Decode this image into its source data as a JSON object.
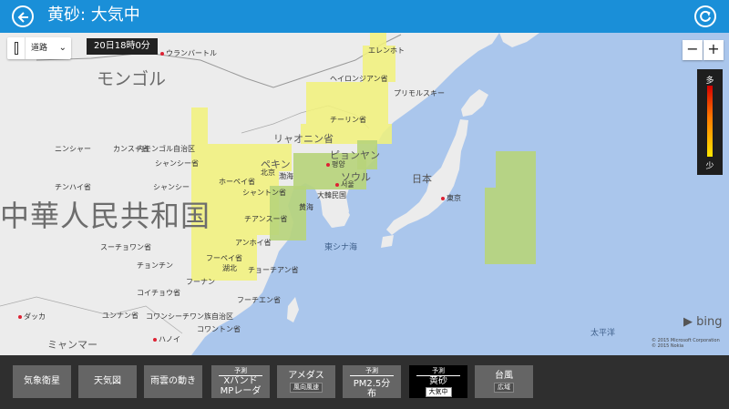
{
  "header": {
    "title": "黄砂: 大気中"
  },
  "map_controls": {
    "layer_select": "道路",
    "time": "20日18時0分",
    "zoom_out": "−",
    "zoom_in": "+",
    "legend": {
      "high": "多",
      "low": "少"
    }
  },
  "map_labels": {
    "mongolia": "モンゴル",
    "china": "中華人民共和国",
    "ulaanbaatar": "ウランバートル",
    "erenhot": "エレンホト",
    "heilongjiang": "ヘイロンジアン省",
    "primorsky": "プリモルスキー",
    "jilin": "チーリン省",
    "liaoning": "リャオニン省",
    "pyongyang": "ピョンヤン",
    "pyongyang_han": "평양",
    "seoul": "ソウル",
    "seoul_han": "서울",
    "korea": "大韓民国",
    "japan": "日本",
    "tokyo": "東京",
    "beijing": "ペキン",
    "beijing_han": "北京",
    "hebei": "ホーペイ省",
    "shandong": "シャントン省",
    "jiangsu": "チアンスー省",
    "anhui": "アンホイ省",
    "hubei": "フーペイ省",
    "hubei_han": "湖北",
    "zhejiang": "チョーチアン省",
    "fujian": "フーチエン省",
    "hunan": "フーナン",
    "jiangxi": "チアンシー",
    "guizhou": "コイチョウ省",
    "chongqing": "チョンチン",
    "sichuan": "スーチョワン省",
    "shaanxi": "シャンシー省",
    "shanxi": "シャンシー",
    "gansu": "カンスー省",
    "ningxia": "ニンシャー",
    "qinghai": "チンハイ省",
    "inner_mongolia": "内モンゴル自治区",
    "yunnan": "ユンナン省",
    "guangxi": "コワンシーチワン族自治区",
    "guangdong": "コワントン省",
    "hanoi": "ハノイ",
    "myanmar": "ミャンマー",
    "dhaka": "ダッカ",
    "east_china_sea": "東シナ海",
    "yellow_sea": "黄海",
    "bohai": "渤海",
    "pacific": "太平洋"
  },
  "map_attribution": {
    "bing": "bing",
    "copyright1": "© 2015 Microsoft Corporation",
    "copyright2": "© 2015 Nokia"
  },
  "toolbar": {
    "satellite": "気象衛星",
    "weather_map": "天気図",
    "rain_cloud": "雨雲の動き",
    "xband": {
      "tag": "予測",
      "line1": "Xバンド",
      "line2": "MPレーダ"
    },
    "amedas": {
      "label": "アメダス",
      "sub": "風向風速"
    },
    "pm25": {
      "tag": "予測",
      "label": "PM2.5分布"
    },
    "kosa": {
      "tag": "予測",
      "label": "黄砂",
      "sub": "大気中"
    },
    "typhoon": {
      "label": "台風",
      "sub": "広域"
    }
  },
  "colors": {
    "header": "#1a8fd8",
    "dust_light": "#f2f27a",
    "dust_mid": "#b7d47a",
    "selected": "#000000"
  }
}
